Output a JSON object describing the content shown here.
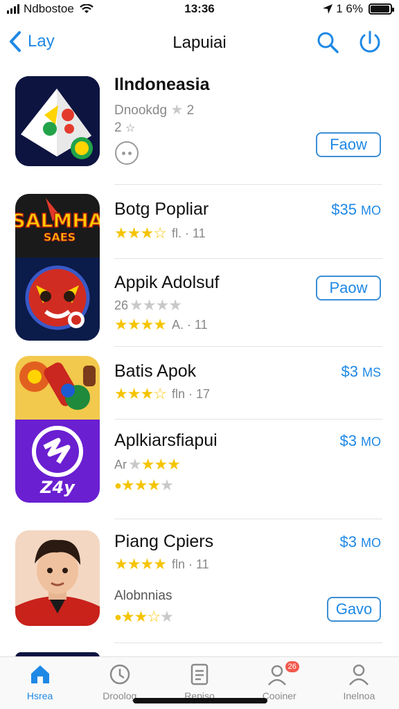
{
  "status_bar": {
    "carrier": "Ndbostoe",
    "time": "13:36",
    "battery": "1 6%",
    "battery_level": 0.95
  },
  "nav": {
    "back_label": "Lay",
    "title": "Lapuiai",
    "icons": [
      "back-chevron-icon",
      "search-icon",
      "power-icon"
    ]
  },
  "apps": [
    {
      "name": "Ilndoneasia",
      "sub": "Dnookdg",
      "sub_rating": 2,
      "line2": "2",
      "button": "Faow",
      "icon": "pyramid-app-icon"
    },
    {
      "name": "Botg Popliar",
      "rating": 3.5,
      "meta": "fl. · 11",
      "price": "$35",
      "price_unit": "MO",
      "icon": "salmha-app-icon"
    },
    {
      "name": "Appik Adolsuf",
      "sub": "26",
      "rating": 4,
      "meta": "A. · 11",
      "button": "Paow",
      "icon": "red-robot-app-icon"
    },
    {
      "name": "Batis Apok",
      "rating": 3.5,
      "meta": "fln · 17",
      "price": "$3",
      "price_unit": "MS",
      "icon": "toys-app-icon"
    },
    {
      "name": "Aplkiarsfiapui",
      "sub": "Ar",
      "rating": 3,
      "icon_text": "Z4y",
      "price": "$3",
      "price_unit": "MO",
      "icon": "purple-z-app-icon"
    },
    {
      "name": "Piang Cpiers",
      "rating": 4,
      "meta": "fln · 11",
      "price": "$3",
      "price_unit": "MO",
      "sub": "Alobnnias",
      "rating2": 2.5,
      "button": "Gavo",
      "icon": "avatar-app-icon"
    }
  ],
  "tabs": [
    {
      "label": "Hsrea",
      "icon": "home-icon",
      "active": true
    },
    {
      "label": "Droolog",
      "icon": "clock-icon"
    },
    {
      "label": "Repiso",
      "icon": "document-icon"
    },
    {
      "label": "Cooiner",
      "icon": "people-icon",
      "badge": "26"
    },
    {
      "label": "Inelnoa",
      "icon": "person-icon"
    }
  ],
  "colors": {
    "accent": "#1e88e5",
    "star": "#f5c400",
    "badge": "#f25a4f"
  }
}
